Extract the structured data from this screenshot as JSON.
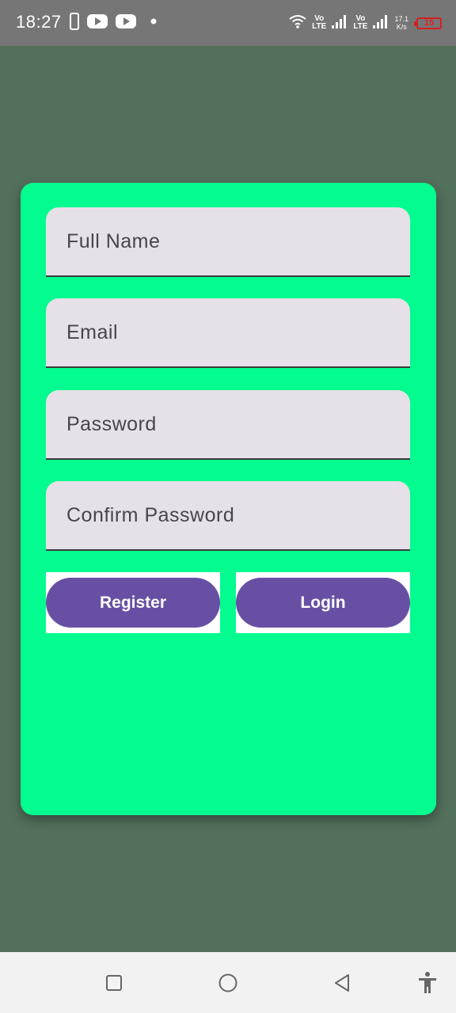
{
  "status_bar": {
    "time": "18:27",
    "volte1": {
      "top": "Vo",
      "bottom": "LTE"
    },
    "volte2": {
      "top": "Vo",
      "bottom": "LTE"
    },
    "speed": {
      "value": "17.1",
      "unit": "K/s"
    },
    "battery": "15",
    "icons": [
      "phone-icon",
      "youtube-icon",
      "youtube-icon",
      "notification-dot-icon",
      "wifi-icon",
      "signal-icon",
      "signal-icon",
      "battery-icon"
    ]
  },
  "form": {
    "full_name_placeholder": "Full Name",
    "email_placeholder": "Email",
    "password_placeholder": "Password",
    "confirm_password_placeholder": "Confirm Password",
    "register_label": "Register",
    "login_label": "Login"
  },
  "nav_bar": {
    "icons": [
      "recents-square-icon",
      "home-circle-icon",
      "back-triangle-icon",
      "accessibility-icon"
    ]
  },
  "colors": {
    "background": "#53705c",
    "card": "#03fc8f",
    "field": "#e6e0e8",
    "button": "#6750a4",
    "status_bar": "#767676",
    "nav_bar": "#f2f2f2"
  }
}
